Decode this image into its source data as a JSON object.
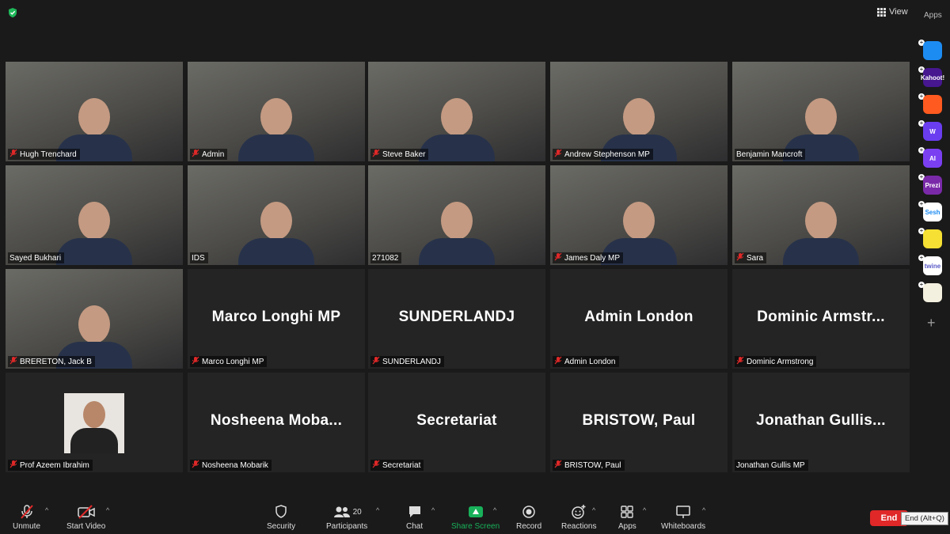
{
  "top": {
    "view_label": "View",
    "apps_label": "Apps"
  },
  "participants": [
    {
      "name": "Hugh Trenchard",
      "video": true,
      "muted": true
    },
    {
      "name": "Admin",
      "video": true,
      "muted": true
    },
    {
      "name": "Steve Baker",
      "video": true,
      "muted": true
    },
    {
      "name": "Andrew Stephenson MP",
      "video": true,
      "muted": true
    },
    {
      "name": "Benjamin Mancroft",
      "video": true,
      "muted": false
    },
    {
      "name": "Sayed Bukhari",
      "video": true,
      "muted": false
    },
    {
      "name": "IDS",
      "video": true,
      "muted": false
    },
    {
      "name": "271082",
      "video": true,
      "muted": false,
      "active": true
    },
    {
      "name": "James Daly MP",
      "video": true,
      "muted": true
    },
    {
      "name": "Sara",
      "video": true,
      "muted": true
    },
    {
      "name": "BRERETON, Jack B",
      "video": true,
      "muted": true
    },
    {
      "name": "Marco Longhi MP",
      "display": "Marco Longhi MP",
      "video": false,
      "muted": true
    },
    {
      "name": "SUNDERLANDJ",
      "display": "SUNDERLANDJ",
      "video": false,
      "muted": true
    },
    {
      "name": "Admin London",
      "display": "Admin London",
      "video": false,
      "muted": true
    },
    {
      "name": "Dominic Armstrong",
      "display": "Dominic  Armstr...",
      "video": false,
      "muted": true
    },
    {
      "name": "Prof Azeem Ibrahim",
      "video": false,
      "avatar": true,
      "muted": true
    },
    {
      "name": "Nosheena Mobarik",
      "display": "Nosheena  Moba...",
      "video": false,
      "muted": true
    },
    {
      "name": "Secretariat",
      "display": "Secretariat",
      "video": false,
      "muted": true
    },
    {
      "name": "BRISTOW, Paul",
      "display": "BRISTOW, Paul",
      "video": false,
      "muted": true
    },
    {
      "name": "Jonathan Gullis MP",
      "display": "Jonathan  Gullis...",
      "video": false,
      "muted": false
    }
  ],
  "rail_apps": [
    {
      "name": "app-1",
      "text": "",
      "color": "#1d8cf2"
    },
    {
      "name": "Kahoot!",
      "text": "Kahoot!",
      "color": "#46178f"
    },
    {
      "name": "app-3",
      "text": "",
      "color": "#ff5a1f"
    },
    {
      "name": "Wooclap",
      "text": "W",
      "color": "#6a3df0"
    },
    {
      "name": "AI",
      "text": "AI",
      "color": "#7b3ff2"
    },
    {
      "name": "Prezi",
      "text": "Prezi",
      "color": "#7a2aa9"
    },
    {
      "name": "Sesh",
      "text": "Sesh",
      "color": "#ffffff",
      "fg": "#1d8cf2"
    },
    {
      "name": "app-8",
      "text": "",
      "color": "#f5e033"
    },
    {
      "name": "twine",
      "text": "twine",
      "color": "#ffffff",
      "fg": "#5a5ac8"
    },
    {
      "name": "app-10",
      "text": "",
      "color": "#f4f0e0"
    }
  ],
  "toolbar": {
    "unmute": "Unmute",
    "start_video": "Start Video",
    "security": "Security",
    "participants": "Participants",
    "participants_count": "20",
    "chat": "Chat",
    "share_screen": "Share Screen",
    "record": "Record",
    "reactions": "Reactions",
    "apps": "Apps",
    "whiteboards": "Whiteboards",
    "end": "End",
    "end_tooltip": "End (Alt+Q)"
  },
  "colors": {
    "share_green": "#18b15a",
    "end_red": "#e02828",
    "muted_red": "#e02828",
    "active_speaker": "#d8e234"
  }
}
